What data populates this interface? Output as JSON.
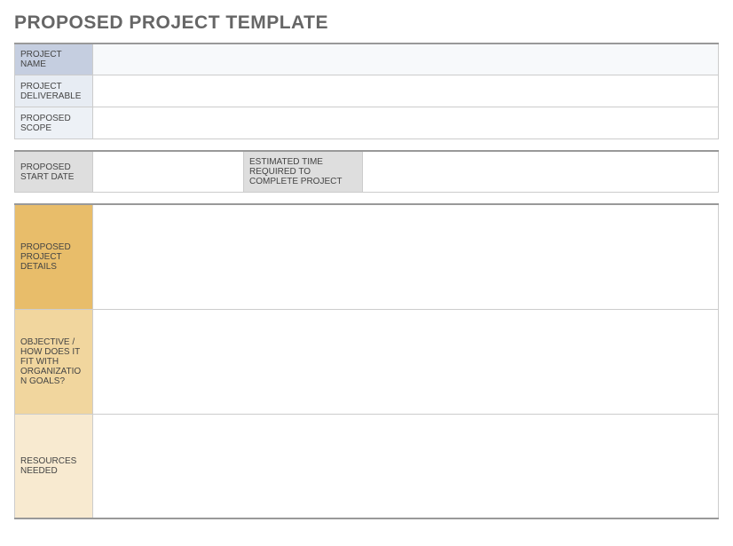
{
  "title": "PROPOSED PROJECT TEMPLATE",
  "section1": {
    "project_name_label": "PROJECT NAME",
    "project_name_value": "",
    "project_deliverable_label": "PROJECT DELIVERABLE",
    "project_deliverable_value": "",
    "proposed_scope_label": "PROPOSED SCOPE",
    "proposed_scope_value": ""
  },
  "section2": {
    "start_date_label": "PROPOSED START DATE",
    "start_date_value": "",
    "est_time_label": "ESTIMATED TIME REQUIRED TO COMPLETE PROJECT",
    "est_time_value": ""
  },
  "section3": {
    "details_label": "PROPOSED PROJECT DETAILS",
    "details_value": "",
    "objective_label": "OBJECTIVE / HOW DOES IT FIT WITH ORGANIZATION GOALS?",
    "objective_value": "",
    "resources_label": "RESOURCES NEEDED",
    "resources_value": ""
  }
}
